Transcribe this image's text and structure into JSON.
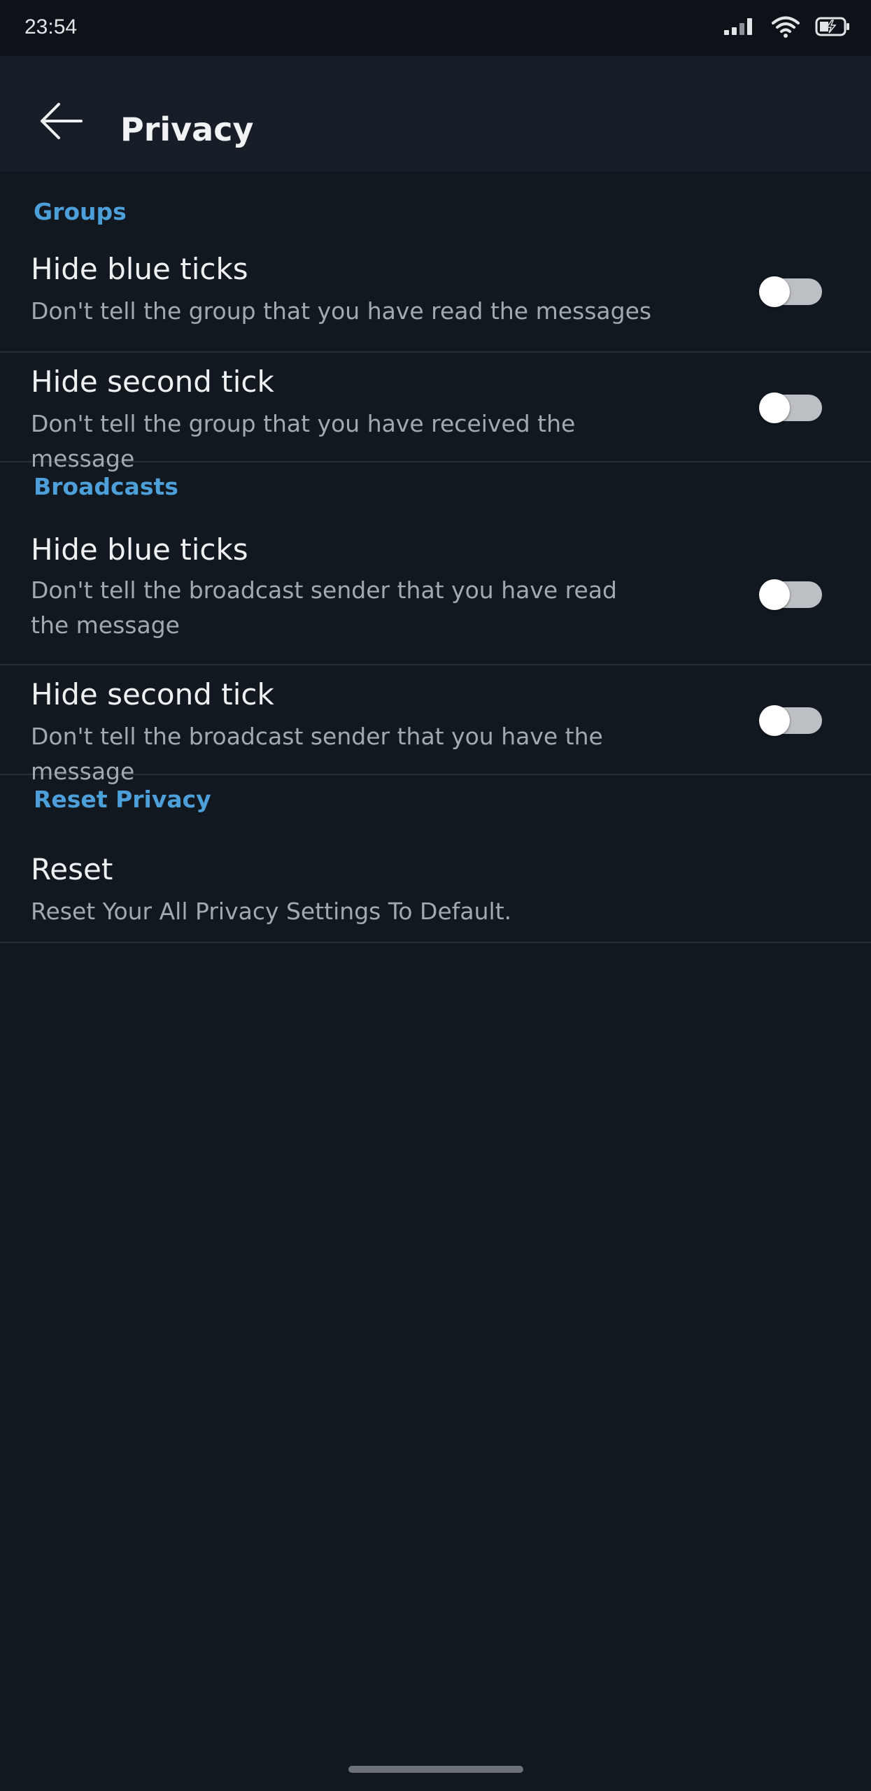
{
  "status_bar": {
    "time": "23:54",
    "icons": [
      "signal-icon",
      "wifi-icon",
      "battery-charging-icon"
    ]
  },
  "app_bar": {
    "back_icon": "arrow-left-icon",
    "title": "Privacy"
  },
  "colors": {
    "background": "#111820",
    "app_bar": "#171e27",
    "section_header": "#4d9fd9",
    "toggle_track_off": "#bcc0c4",
    "toggle_knob": "#ffffff"
  },
  "sections": {
    "groups": {
      "header": "Groups",
      "items": [
        {
          "title": "Hide blue ticks",
          "description": "Don't tell the group that you have read the messages",
          "enabled": false
        },
        {
          "title": "Hide second tick",
          "description": "Don't tell the group that you have received the message",
          "enabled": false
        }
      ]
    },
    "broadcasts": {
      "header": "Broadcasts",
      "items": [
        {
          "title": "Hide blue ticks",
          "description": "Don't tell the broadcast sender that you have read the message",
          "enabled": false
        },
        {
          "title": "Hide second tick",
          "description": "Don't tell the broadcast sender that you have the message",
          "enabled": false
        }
      ]
    },
    "reset": {
      "header": "Reset Privacy",
      "items": [
        {
          "title": "Reset",
          "description": "Reset Your All Privacy Settings To Default."
        }
      ]
    }
  }
}
